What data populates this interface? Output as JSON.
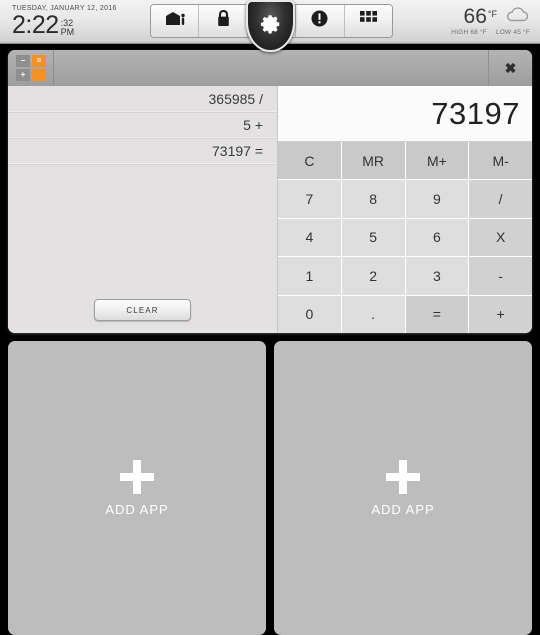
{
  "statusbar": {
    "date": "TUESDAY, JANUARY 12, 2016",
    "time": "2:22",
    "seconds": ":32",
    "ampm": "PM",
    "weather": {
      "temp": "66",
      "unit": "°F",
      "high": "HIGH 68 °F",
      "low": "LOW 45 °F",
      "icon": "cloud-icon"
    },
    "toolbar": [
      {
        "name": "building-icon",
        "label": "Building"
      },
      {
        "name": "lock-icon",
        "label": "Lock"
      },
      {
        "name": "gear-icon",
        "label": "Settings"
      },
      {
        "name": "info-icon",
        "label": "Info"
      },
      {
        "name": "grid-icon",
        "label": "Apps"
      }
    ]
  },
  "calculator": {
    "app_icon": "calculator-icon",
    "icon_cells": [
      "−",
      "=",
      "+",
      ""
    ],
    "close_label": "✖",
    "display_value": "73197",
    "tape": [
      "365985 /",
      "5 +",
      "73197 ="
    ],
    "clear_label": "CLEAR",
    "keys": [
      {
        "label": "C",
        "type": "fn"
      },
      {
        "label": "MR",
        "type": "fn"
      },
      {
        "label": "M+",
        "type": "fn"
      },
      {
        "label": "M-",
        "type": "fn"
      },
      {
        "label": "7",
        "type": "num"
      },
      {
        "label": "8",
        "type": "num"
      },
      {
        "label": "9",
        "type": "num"
      },
      {
        "label": "/",
        "type": "op"
      },
      {
        "label": "4",
        "type": "num"
      },
      {
        "label": "5",
        "type": "num"
      },
      {
        "label": "6",
        "type": "num"
      },
      {
        "label": "X",
        "type": "op"
      },
      {
        "label": "1",
        "type": "num"
      },
      {
        "label": "2",
        "type": "num"
      },
      {
        "label": "3",
        "type": "num"
      },
      {
        "label": "-",
        "type": "op"
      },
      {
        "label": "0",
        "type": "num"
      },
      {
        "label": ".",
        "type": "num"
      },
      {
        "label": "=",
        "type": "eq"
      },
      {
        "label": "+",
        "type": "op"
      }
    ]
  },
  "panels": [
    {
      "label": "ADD APP",
      "icon": "plus-icon"
    },
    {
      "label": "ADD APP",
      "icon": "plus-icon"
    }
  ],
  "colors": {
    "accent_orange": "#f29125",
    "panel_gray": "#bdbdbd",
    "window_gray": "#e3e1e1",
    "background": "#000000"
  }
}
